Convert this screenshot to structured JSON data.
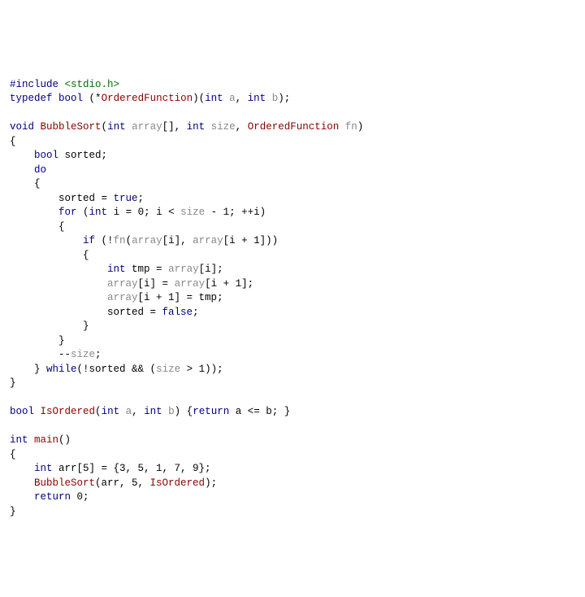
{
  "code": {
    "l01": {
      "a": "#include ",
      "b": "<stdio.h>"
    },
    "l02": {
      "a": "typedef",
      "b": " ",
      "c": "bool",
      "d": " (*",
      "e": "OrderedFunction",
      "f": ")(",
      "g": "int",
      "h": " ",
      "i": "a",
      "j": ", ",
      "k": "int",
      "l": " ",
      "m": "b",
      "n": ");"
    },
    "l03": "",
    "l04": {
      "a": "void",
      "b": " ",
      "c": "BubbleSort",
      "d": "(",
      "e": "int",
      "f": " ",
      "g": "array",
      "h": "[], ",
      "i": "int",
      "j": " ",
      "k": "size",
      "l": ", ",
      "m": "OrderedFunction",
      "n": " ",
      "o": "fn",
      "p": ")"
    },
    "l05": "{",
    "l06": {
      "a": "    ",
      "b": "bool",
      "c": " sorted;"
    },
    "l07": {
      "a": "    ",
      "b": "do"
    },
    "l08": "    {",
    "l09": {
      "a": "        sorted = ",
      "b": "true",
      "c": ";"
    },
    "l10": {
      "a": "        ",
      "b": "for",
      "c": " (",
      "d": "int",
      "e": " i = 0; i < ",
      "f": "size",
      "g": " - 1; ++i)"
    },
    "l11": "        {",
    "l12": {
      "a": "            ",
      "b": "if",
      "c": " (!",
      "d": "fn",
      "e": "(",
      "f": "array",
      "g": "[i], ",
      "h": "array",
      "i": "[i + 1]))"
    },
    "l13": "            {",
    "l14": {
      "a": "                ",
      "b": "int",
      "c": " tmp = ",
      "d": "array",
      "e": "[i];"
    },
    "l15": {
      "a": "                ",
      "b": "array",
      "c": "[i] = ",
      "d": "array",
      "e": "[i + 1];"
    },
    "l16": {
      "a": "                ",
      "b": "array",
      "c": "[i + 1] = tmp;"
    },
    "l17": {
      "a": "                sorted = ",
      "b": "false",
      "c": ";"
    },
    "l18": "            }",
    "l19": "        }",
    "l20": {
      "a": "        --",
      "b": "size",
      "c": ";"
    },
    "l21": {
      "a": "    } ",
      "b": "while",
      "c": "(!sorted && (",
      "d": "size",
      "e": " > 1));"
    },
    "l22": "}",
    "l23": "",
    "l24": {
      "a": "bool",
      "b": " ",
      "c": "IsOrdered",
      "d": "(",
      "e": "int",
      "f": " ",
      "g": "a",
      "h": ", ",
      "i": "int",
      "j": " ",
      "k": "b",
      "l": ") {",
      "m": "return",
      "n": " a <= b; }"
    },
    "l25": "",
    "l26": {
      "a": "int",
      "b": " ",
      "c": "main",
      "d": "()"
    },
    "l27": "{",
    "l28": {
      "a": "    ",
      "b": "int",
      "c": " arr[5] = {3, 5, 1, 7, 9};"
    },
    "l29": {
      "a": "    ",
      "b": "BubbleSort",
      "c": "(arr, 5, ",
      "d": "IsOrdered",
      "e": ");"
    },
    "l30": {
      "a": "    ",
      "b": "return",
      "c": " 0;"
    },
    "l31": "}"
  }
}
